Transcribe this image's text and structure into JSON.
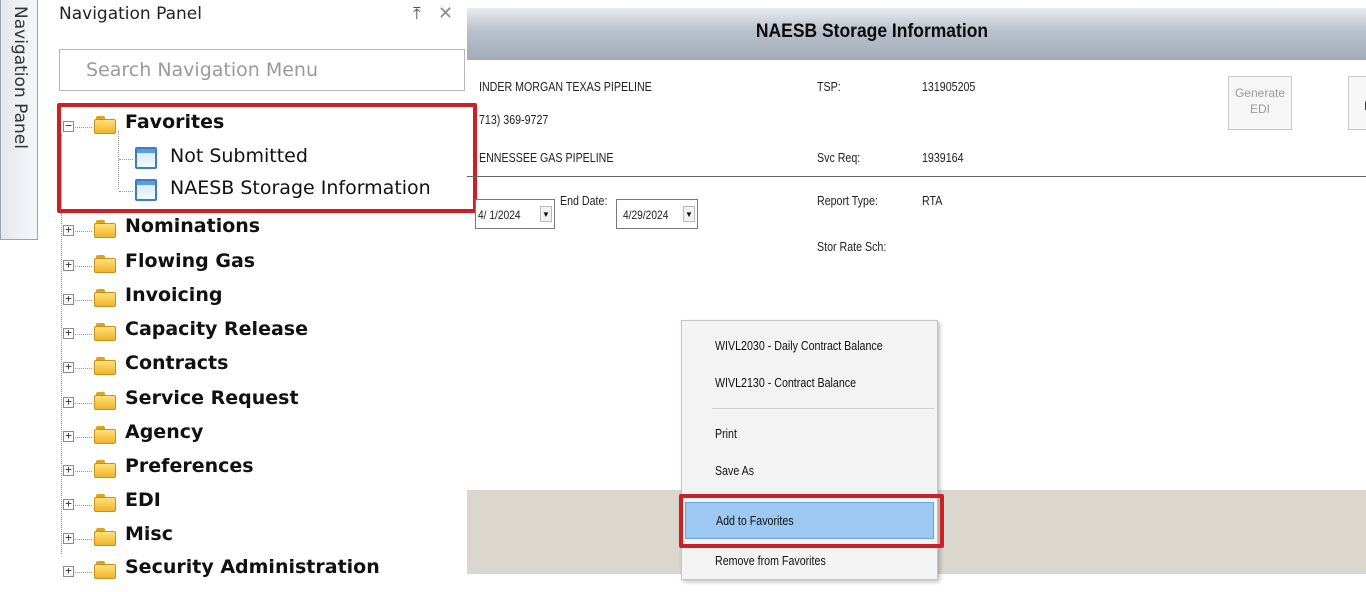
{
  "side_tab": {
    "label": "Navigation Panel"
  },
  "nav_panel": {
    "title": "Navigation Panel",
    "pin_glyph": "⤒",
    "close_glyph": "✕",
    "search_placeholder": "Search Navigation Menu",
    "favorites": {
      "label": "Favorites",
      "expander": "−",
      "items": [
        {
          "label": "Not Submitted"
        },
        {
          "label": "NAESB Storage Information"
        }
      ]
    },
    "categories": [
      {
        "label": "Nominations",
        "expander": "+"
      },
      {
        "label": "Flowing Gas",
        "expander": "+"
      },
      {
        "label": "Invoicing",
        "expander": "+"
      },
      {
        "label": "Capacity Release",
        "expander": "+"
      },
      {
        "label": "Contracts",
        "expander": "+"
      },
      {
        "label": "Service Request",
        "expander": "+"
      },
      {
        "label": "Agency",
        "expander": "+"
      },
      {
        "label": "Preferences",
        "expander": "+"
      },
      {
        "label": "EDI",
        "expander": "+"
      },
      {
        "label": "Misc",
        "expander": "+"
      },
      {
        "label": "Security Administration",
        "expander": "+"
      }
    ]
  },
  "main": {
    "title": "NAESB Storage Information",
    "pipeline_name": "INDER MORGAN TEXAS PIPELINE",
    "phone": "713) 369-9727",
    "shipper_name": "ENNESSEE GAS PIPELINE",
    "tsp_label": "TSP:",
    "tsp_value": "131905205",
    "svc_req_label": "Svc Req:",
    "svc_req_value": "1939164",
    "report_type_label": "Report Type:",
    "report_type_value": "RTA",
    "stor_rate_label": "Stor Rate Sch:",
    "begin_date_value": "4/ 1/2024",
    "end_date_label": "End Date:",
    "end_date_value": "4/29/2024",
    "generate_edi_line1": "Generate",
    "generate_edi_line2": "EDI",
    "r_button_label": "R",
    "dropdown_glyph": "▼"
  },
  "context_menu": {
    "items": [
      {
        "label": "WIVL2030 - Daily Contract Balance"
      },
      {
        "label": "WIVL2130 - Contract Balance"
      },
      {
        "label": "Print"
      },
      {
        "label": "Save As"
      },
      {
        "label": "Add to Favorites",
        "highlighted": true
      },
      {
        "label": "Remove from Favorites"
      }
    ]
  },
  "colors": {
    "highlight_box": "#cc2027",
    "menu_highlight": "#9cc8f2",
    "header_gradient_dark": "#a2acb9",
    "folder_yellow": "#f0b42a",
    "doc_blue": "#3a7cc5"
  },
  "icons": {
    "folder": "folder-icon",
    "document": "document-icon",
    "pin": "pin-icon",
    "close": "close-icon",
    "expand": "expand-icon",
    "collapse": "collapse-icon",
    "dropdown": "dropdown-arrow-icon"
  }
}
